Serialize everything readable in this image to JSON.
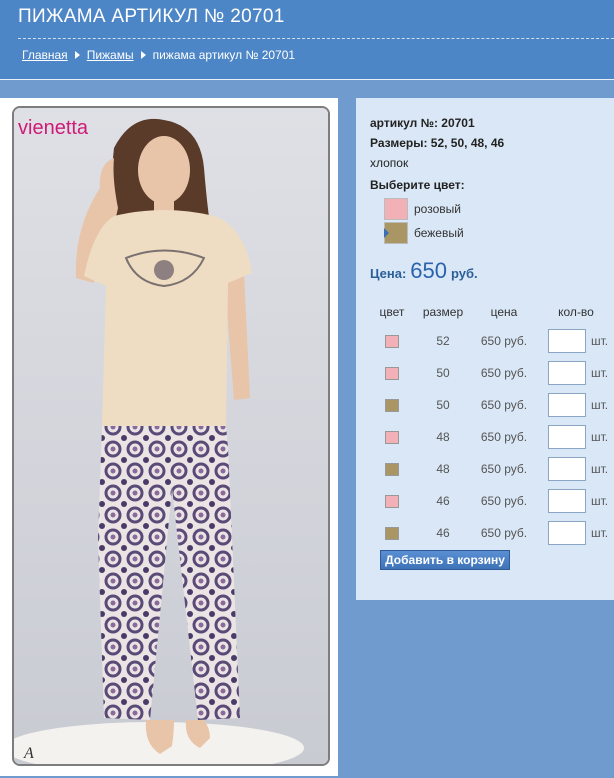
{
  "header": {
    "title": "ПИЖАМА АРТИКУЛ № 20701",
    "breadcrumb": [
      {
        "label": "Главная",
        "link": true
      },
      {
        "label": "Пижамы",
        "link": true
      },
      {
        "label": "пижама артикул № 20701",
        "link": false
      }
    ]
  },
  "photo": {
    "brand": "vienetta",
    "corner_mark": "A"
  },
  "details": {
    "article": "артикул №: 20701",
    "sizes": "Размеры: 52, 50, 48, 46",
    "material": "хлопок",
    "choose_color_label": "Выберите цвет:",
    "colors": [
      {
        "label": "розовый",
        "hex": "#f2b1b7"
      },
      {
        "label": "бежевый",
        "hex": "#aa9565",
        "selected": true
      }
    ],
    "price_label": "Цена:",
    "price_value": "650",
    "price_currency": "руб."
  },
  "table": {
    "headers": [
      "цвет",
      "размер",
      "цена",
      "кол-во"
    ],
    "unit": "шт.",
    "rows": [
      {
        "color": "#f2b1b7",
        "size": "52",
        "price": "650 руб."
      },
      {
        "color": "#f2b1b7",
        "size": "50",
        "price": "650 руб."
      },
      {
        "color": "#aa9565",
        "size": "50",
        "price": "650 руб."
      },
      {
        "color": "#f2b1b7",
        "size": "48",
        "price": "650 руб."
      },
      {
        "color": "#aa9565",
        "size": "48",
        "price": "650 руб."
      },
      {
        "color": "#f2b1b7",
        "size": "46",
        "price": "650 руб."
      },
      {
        "color": "#aa9565",
        "size": "46",
        "price": "650 руб."
      }
    ]
  },
  "add_to_cart_label": "Добавить в корзину",
  "colors": {
    "header_bg": "#4d86c6",
    "page_bg": "#6f9bcf",
    "panel_bg": "#d9e7f6",
    "price_accent": "#2a63ad"
  }
}
